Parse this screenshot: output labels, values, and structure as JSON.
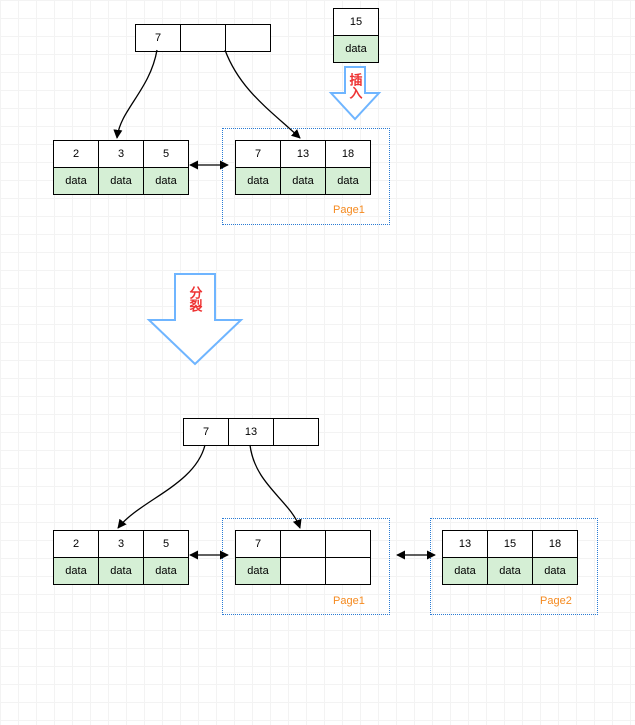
{
  "chart_data": {
    "type": "tree-diagram",
    "phase": "B+ tree leaf split on insert",
    "insert_record": {
      "key": 15,
      "payload": "data"
    },
    "before": {
      "root": {
        "keys": [
          7,
          null,
          null
        ]
      },
      "leaves": [
        {
          "keys": [
            2,
            3,
            5
          ],
          "payloads": [
            "data",
            "data",
            "data"
          ]
        },
        {
          "keys": [
            7,
            13,
            18
          ],
          "payloads": [
            "data",
            "data",
            "data"
          ],
          "page": "Page1"
        }
      ]
    },
    "after": {
      "root": {
        "keys": [
          7,
          13,
          null
        ]
      },
      "leaves": [
        {
          "keys": [
            2,
            3,
            5
          ],
          "payloads": [
            "data",
            "data",
            "data"
          ]
        },
        {
          "keys": [
            7,
            null,
            null
          ],
          "payloads": [
            "data",
            null,
            null
          ],
          "page": "Page1"
        },
        {
          "keys": [
            13,
            15,
            18
          ],
          "payloads": [
            "data",
            "data",
            "data"
          ],
          "page": "Page2"
        }
      ]
    }
  },
  "labels": {
    "insert_arrow": "插入",
    "split_arrow": "分裂",
    "data_word": "data",
    "page1": "Page1",
    "page2": "Page2"
  }
}
